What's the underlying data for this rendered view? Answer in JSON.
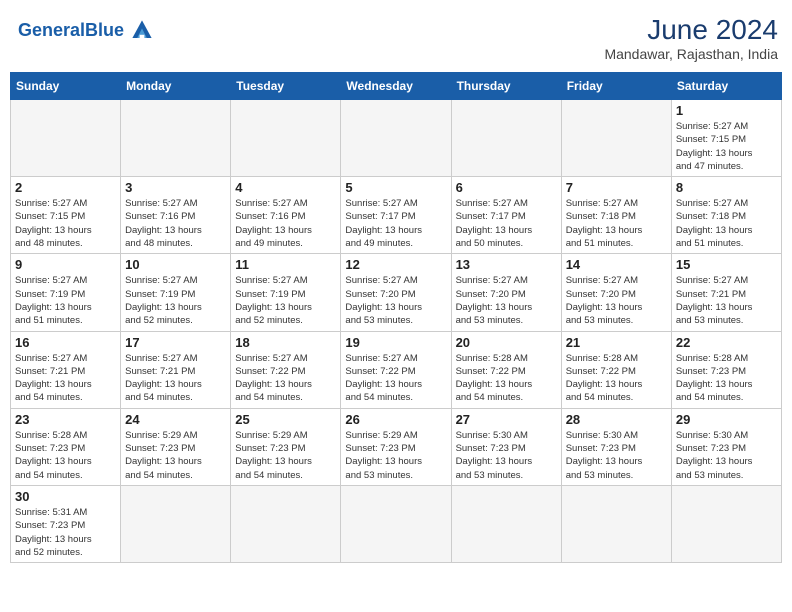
{
  "header": {
    "logo_general": "General",
    "logo_blue": "Blue",
    "month_year": "June 2024",
    "location": "Mandawar, Rajasthan, India"
  },
  "days_of_week": [
    "Sunday",
    "Monday",
    "Tuesday",
    "Wednesday",
    "Thursday",
    "Friday",
    "Saturday"
  ],
  "weeks": [
    [
      {
        "day": "",
        "info": ""
      },
      {
        "day": "",
        "info": ""
      },
      {
        "day": "",
        "info": ""
      },
      {
        "day": "",
        "info": ""
      },
      {
        "day": "",
        "info": ""
      },
      {
        "day": "",
        "info": ""
      },
      {
        "day": "1",
        "info": "Sunrise: 5:27 AM\nSunset: 7:15 PM\nDaylight: 13 hours\nand 47 minutes."
      }
    ],
    [
      {
        "day": "2",
        "info": "Sunrise: 5:27 AM\nSunset: 7:15 PM\nDaylight: 13 hours\nand 48 minutes."
      },
      {
        "day": "3",
        "info": "Sunrise: 5:27 AM\nSunset: 7:16 PM\nDaylight: 13 hours\nand 48 minutes."
      },
      {
        "day": "4",
        "info": "Sunrise: 5:27 AM\nSunset: 7:16 PM\nDaylight: 13 hours\nand 49 minutes."
      },
      {
        "day": "5",
        "info": "Sunrise: 5:27 AM\nSunset: 7:17 PM\nDaylight: 13 hours\nand 49 minutes."
      },
      {
        "day": "6",
        "info": "Sunrise: 5:27 AM\nSunset: 7:17 PM\nDaylight: 13 hours\nand 50 minutes."
      },
      {
        "day": "7",
        "info": "Sunrise: 5:27 AM\nSunset: 7:18 PM\nDaylight: 13 hours\nand 51 minutes."
      },
      {
        "day": "8",
        "info": "Sunrise: 5:27 AM\nSunset: 7:18 PM\nDaylight: 13 hours\nand 51 minutes."
      }
    ],
    [
      {
        "day": "9",
        "info": "Sunrise: 5:27 AM\nSunset: 7:19 PM\nDaylight: 13 hours\nand 51 minutes."
      },
      {
        "day": "10",
        "info": "Sunrise: 5:27 AM\nSunset: 7:19 PM\nDaylight: 13 hours\nand 52 minutes."
      },
      {
        "day": "11",
        "info": "Sunrise: 5:27 AM\nSunset: 7:19 PM\nDaylight: 13 hours\nand 52 minutes."
      },
      {
        "day": "12",
        "info": "Sunrise: 5:27 AM\nSunset: 7:20 PM\nDaylight: 13 hours\nand 53 minutes."
      },
      {
        "day": "13",
        "info": "Sunrise: 5:27 AM\nSunset: 7:20 PM\nDaylight: 13 hours\nand 53 minutes."
      },
      {
        "day": "14",
        "info": "Sunrise: 5:27 AM\nSunset: 7:20 PM\nDaylight: 13 hours\nand 53 minutes."
      },
      {
        "day": "15",
        "info": "Sunrise: 5:27 AM\nSunset: 7:21 PM\nDaylight: 13 hours\nand 53 minutes."
      }
    ],
    [
      {
        "day": "16",
        "info": "Sunrise: 5:27 AM\nSunset: 7:21 PM\nDaylight: 13 hours\nand 54 minutes."
      },
      {
        "day": "17",
        "info": "Sunrise: 5:27 AM\nSunset: 7:21 PM\nDaylight: 13 hours\nand 54 minutes."
      },
      {
        "day": "18",
        "info": "Sunrise: 5:27 AM\nSunset: 7:22 PM\nDaylight: 13 hours\nand 54 minutes."
      },
      {
        "day": "19",
        "info": "Sunrise: 5:27 AM\nSunset: 7:22 PM\nDaylight: 13 hours\nand 54 minutes."
      },
      {
        "day": "20",
        "info": "Sunrise: 5:28 AM\nSunset: 7:22 PM\nDaylight: 13 hours\nand 54 minutes."
      },
      {
        "day": "21",
        "info": "Sunrise: 5:28 AM\nSunset: 7:22 PM\nDaylight: 13 hours\nand 54 minutes."
      },
      {
        "day": "22",
        "info": "Sunrise: 5:28 AM\nSunset: 7:23 PM\nDaylight: 13 hours\nand 54 minutes."
      }
    ],
    [
      {
        "day": "23",
        "info": "Sunrise: 5:28 AM\nSunset: 7:23 PM\nDaylight: 13 hours\nand 54 minutes."
      },
      {
        "day": "24",
        "info": "Sunrise: 5:29 AM\nSunset: 7:23 PM\nDaylight: 13 hours\nand 54 minutes."
      },
      {
        "day": "25",
        "info": "Sunrise: 5:29 AM\nSunset: 7:23 PM\nDaylight: 13 hours\nand 54 minutes."
      },
      {
        "day": "26",
        "info": "Sunrise: 5:29 AM\nSunset: 7:23 PM\nDaylight: 13 hours\nand 53 minutes."
      },
      {
        "day": "27",
        "info": "Sunrise: 5:30 AM\nSunset: 7:23 PM\nDaylight: 13 hours\nand 53 minutes."
      },
      {
        "day": "28",
        "info": "Sunrise: 5:30 AM\nSunset: 7:23 PM\nDaylight: 13 hours\nand 53 minutes."
      },
      {
        "day": "29",
        "info": "Sunrise: 5:30 AM\nSunset: 7:23 PM\nDaylight: 13 hours\nand 53 minutes."
      }
    ],
    [
      {
        "day": "30",
        "info": "Sunrise: 5:31 AM\nSunset: 7:23 PM\nDaylight: 13 hours\nand 52 minutes."
      },
      {
        "day": "",
        "info": ""
      },
      {
        "day": "",
        "info": ""
      },
      {
        "day": "",
        "info": ""
      },
      {
        "day": "",
        "info": ""
      },
      {
        "day": "",
        "info": ""
      },
      {
        "day": "",
        "info": ""
      }
    ]
  ]
}
